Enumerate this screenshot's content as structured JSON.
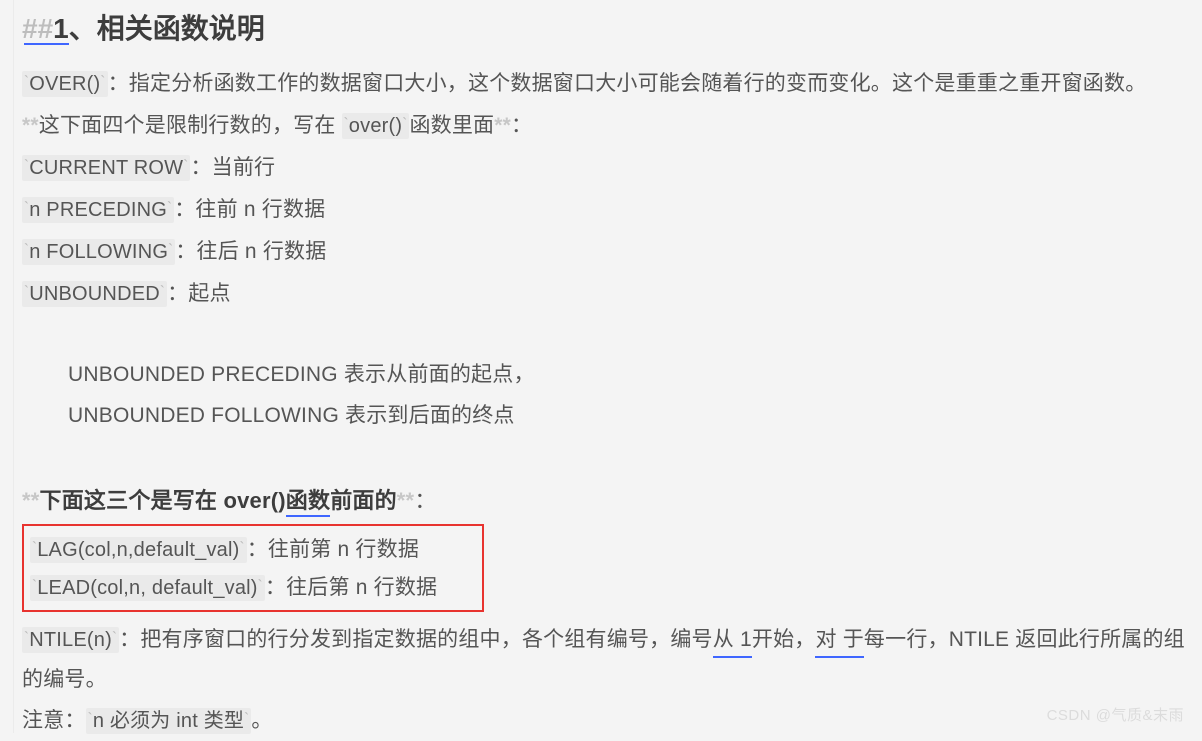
{
  "page": {
    "background_color": "#f4f4f4",
    "text_color": "#555555"
  },
  "heading": {
    "hashes": "##",
    "number": "1",
    "rest": "、相关函数说明"
  },
  "intro": {
    "code": "OVER()",
    "tick": "`",
    "text": "：指定分析函数工作的数据窗口大小，这个数据窗口大小可能会随着行的变而变化。这个是重重之重开窗函数。"
  },
  "limit_line": {
    "stars_open": "**",
    "text_before": "这下面四个是限制行数的，写在 ",
    "code": "over()",
    "text_after": "函数里面",
    "stars_close": "**",
    "colon": "："
  },
  "frame_items": [
    {
      "code": "CURRENT ROW",
      "desc": "：当前行"
    },
    {
      "code": "n PRECEDING",
      "desc": "：往前 n 行数据"
    },
    {
      "code": "n FOLLOWING",
      "desc": "：往后 n 行数据"
    },
    {
      "code": "UNBOUNDED",
      "desc": "：起点"
    }
  ],
  "quote_block": [
    "UNBOUNDED PRECEDING 表示从前面的起点，",
    "UNBOUNDED FOLLOWING 表示到后面的终点"
  ],
  "lead_bold": {
    "stars_open": "**",
    "text_a": "下面这三个是写在 ",
    "text_b": "over()",
    "text_c": " 函数",
    "text_d": "前面的",
    "stars_close": "**",
    "colon": "："
  },
  "red_box": {
    "border_color": "#e8332f",
    "rows": [
      {
        "code": "LAG(col,n,default_val)",
        "desc": "：往前第 n 行数据"
      },
      {
        "code": "LEAD(col,n, default_val)",
        "desc": "：往后第 n 行数据"
      }
    ]
  },
  "ntile": {
    "code": "NTILE(n)",
    "text_1": "：把有序窗口的行分发到指定数据的组中，各个组有编号，编号",
    "underline_1": "从 1",
    "text_2": "开始，",
    "underline_2": "对 于",
    "text_3": "每一行，NTILE 返回此行所属的组的编号。"
  },
  "note": {
    "label": "注意：",
    "code": "n 必须为 int 类型",
    "end": "。"
  },
  "watermark": {
    "text": "CSDN @气质&末雨",
    "color": "#dcdcdc"
  }
}
